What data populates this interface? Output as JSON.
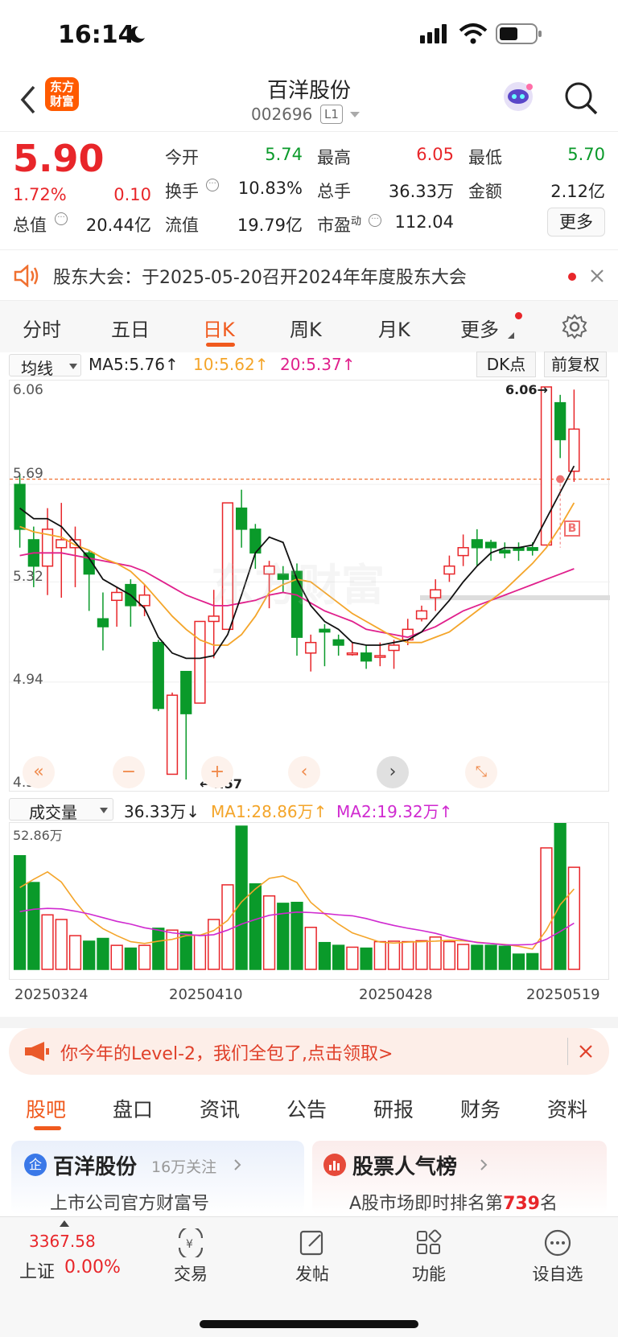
{
  "status": {
    "time": "16:14"
  },
  "header": {
    "logo_text": "东方财富",
    "stock_name": "百洋股份",
    "stock_code": "002696",
    "level": "L1"
  },
  "quote": {
    "price": "5.90",
    "change_pct": "1.72%",
    "change": "0.10",
    "fields": [
      {
        "label": "今开",
        "value": "5.74",
        "color": "green"
      },
      {
        "label": "最高",
        "value": "6.05",
        "color": "red"
      },
      {
        "label": "最低",
        "value": "5.70",
        "color": "green"
      },
      {
        "label": "换手",
        "value": "10.83%",
        "color": "black"
      },
      {
        "label": "总手",
        "value": "36.33万",
        "color": "black"
      },
      {
        "label": "金额",
        "value": "2.12亿",
        "color": "black"
      },
      {
        "label": "总值",
        "value": "20.44亿",
        "color": "black"
      },
      {
        "label": "流值",
        "value": "19.79亿",
        "color": "black"
      },
      {
        "label": "市盈",
        "sup": "动",
        "value": "112.04",
        "color": "black"
      }
    ],
    "more": "更多"
  },
  "notice": {
    "text": "股东大会：于2025-05-20召开2024年年度股东大会"
  },
  "ktabs": [
    "分时",
    "五日",
    "日K",
    "周K",
    "月K",
    "更多"
  ],
  "ktab_active": 2,
  "ma_bar": {
    "selector": "均线",
    "ma5": "MA5:5.76",
    "ma10": "10:5.62",
    "ma20": "20:5.37",
    "dk": "DK点",
    "fq": "前复权"
  },
  "kchart": {
    "ymax": "6.06",
    "y2": "5.69",
    "y3": "5.32",
    "y4": "4.94",
    "ymin": "4.57",
    "hi_label": "6.06→",
    "lo_label": "←4.57",
    "watermark": "东方财富",
    "b_mark": "B"
  },
  "vol_bar": {
    "selector": "成交量",
    "vol": "36.33万",
    "ma1": "MA1:28.86万",
    "ma2": "MA2:19.32万",
    "vmax": "52.86万"
  },
  "dates": [
    "20250324",
    "20250410",
    "20250428",
    "20250519"
  ],
  "banner": {
    "text": "你今年的Level-2，我们全包了,点击领取>"
  },
  "btabs": [
    "股吧",
    "盘口",
    "资讯",
    "公告",
    "研报",
    "财务",
    "资料"
  ],
  "btab_active": 0,
  "card_left": {
    "title": "百洋股份",
    "follow": "16万关注",
    "sub": "上市公司官方财富号"
  },
  "card_right": {
    "title": "股票人气榜",
    "sub_pre": "A股市场即时排名第",
    "rank": "739",
    "sub_post": "名"
  },
  "tabbar": {
    "index_value": "3367.58",
    "index_name": "上证",
    "index_change": "0.00%",
    "items": [
      "交易",
      "发帖",
      "功能",
      "设自选"
    ]
  },
  "chart_data": {
    "type": "candlestick",
    "ylim": [
      4.57,
      6.06
    ],
    "candles": [
      [
        5.69,
        5.52,
        5.73,
        5.45
      ],
      [
        5.48,
        5.38,
        5.53,
        5.3
      ],
      [
        5.38,
        5.52,
        5.6,
        5.27
      ],
      [
        5.45,
        5.48,
        5.62,
        5.26
      ],
      [
        5.45,
        5.48,
        5.53,
        5.3
      ],
      [
        5.43,
        5.35,
        5.44,
        5.21
      ],
      [
        5.18,
        5.15,
        5.28,
        5.06
      ],
      [
        5.25,
        5.28,
        5.3,
        5.15
      ],
      [
        5.31,
        5.23,
        5.33,
        5.15
      ],
      [
        5.23,
        5.27,
        5.31,
        5.19
      ],
      [
        5.09,
        4.84,
        5.1,
        4.83
      ],
      [
        4.59,
        4.89,
        4.9,
        4.59
      ],
      [
        4.98,
        4.82,
        4.98,
        4.57
      ],
      [
        4.86,
        5.17,
        5.17,
        4.86
      ],
      [
        5.17,
        5.19,
        5.29,
        5.03
      ],
      [
        5.14,
        5.62,
        5.62,
        5.14
      ],
      [
        5.6,
        5.52,
        5.67,
        5.45
      ],
      [
        5.52,
        5.43,
        5.54,
        5.37
      ],
      [
        5.35,
        5.38,
        5.4,
        5.22
      ],
      [
        5.35,
        5.33,
        5.38,
        5.28
      ],
      [
        5.36,
        5.11,
        5.39,
        5.04
      ],
      [
        5.05,
        5.09,
        5.12,
        4.98
      ],
      [
        5.14,
        5.13,
        5.16,
        5.0
      ],
      [
        5.1,
        5.08,
        5.12,
        5.04
      ],
      [
        5.05,
        5.05,
        5.09,
        5.04
      ],
      [
        5.05,
        5.02,
        5.08,
        4.99
      ],
      [
        5.04,
        5.04,
        5.09,
        5.0
      ],
      [
        5.06,
        5.08,
        5.1,
        4.99
      ],
      [
        5.1,
        5.14,
        5.18,
        5.08
      ],
      [
        5.18,
        5.21,
        5.23,
        5.17
      ],
      [
        5.26,
        5.29,
        5.33,
        5.21
      ],
      [
        5.35,
        5.38,
        5.42,
        5.32
      ],
      [
        5.42,
        5.45,
        5.5,
        5.38
      ],
      [
        5.48,
        5.45,
        5.52,
        5.38
      ],
      [
        5.47,
        5.45,
        5.48,
        5.4
      ],
      [
        5.44,
        5.43,
        5.47,
        5.41
      ],
      [
        5.45,
        5.44,
        5.47,
        5.4
      ],
      [
        5.45,
        5.44,
        5.47,
        5.42
      ],
      [
        5.46,
        6.06,
        6.06,
        5.47
      ],
      [
        6.0,
        5.86,
        6.03,
        5.79
      ],
      [
        5.74,
        5.9,
        6.05,
        5.7
      ]
    ],
    "ma5": [
      5.6,
      5.56,
      5.56,
      5.53,
      5.47,
      5.41,
      5.33,
      5.3,
      5.27,
      5.22,
      5.11,
      5.05,
      5.03,
      5.03,
      5.04,
      5.12,
      5.27,
      5.43,
      5.49,
      5.47,
      5.33,
      5.23,
      5.17,
      5.14,
      5.09,
      5.08,
      5.08,
      5.09,
      5.1,
      5.13,
      5.19,
      5.25,
      5.32,
      5.38,
      5.43,
      5.45,
      5.45,
      5.46,
      5.56,
      5.66,
      5.76
    ],
    "ma10": [
      5.53,
      5.51,
      5.5,
      5.49,
      5.46,
      5.44,
      5.41,
      5.39,
      5.36,
      5.31,
      5.25,
      5.19,
      5.14,
      5.1,
      5.08,
      5.08,
      5.12,
      5.19,
      5.28,
      5.31,
      5.33,
      5.32,
      5.28,
      5.24,
      5.2,
      5.17,
      5.14,
      5.11,
      5.09,
      5.09,
      5.11,
      5.13,
      5.17,
      5.21,
      5.25,
      5.29,
      5.34,
      5.39,
      5.45,
      5.53,
      5.62
    ],
    "ma20": [
      5.42,
      5.43,
      5.43,
      5.43,
      5.42,
      5.41,
      5.4,
      5.39,
      5.38,
      5.36,
      5.33,
      5.3,
      5.27,
      5.25,
      5.23,
      5.23,
      5.24,
      5.25,
      5.27,
      5.28,
      5.27,
      5.24,
      5.21,
      5.19,
      5.17,
      5.14,
      5.13,
      5.12,
      5.11,
      5.13,
      5.15,
      5.18,
      5.21,
      5.23,
      5.25,
      5.27,
      5.29,
      5.31,
      5.33,
      5.35,
      5.37
    ],
    "volume": [
      24.6,
      18.8,
      11.8,
      10.8,
      7.3,
      6.1,
      6.7,
      5.2,
      4.6,
      5.2,
      8.9,
      8.5,
      8.1,
      7.4,
      10.8,
      18.3,
      31.0,
      18.5,
      15.9,
      14.3,
      14.5,
      9.1,
      5.8,
      5.2,
      4.8,
      4.6,
      6.0,
      6.1,
      6.0,
      6.2,
      7.0,
      6.0,
      5.4,
      5.2,
      5.2,
      5.0,
      3.3,
      3.4,
      26.3,
      32.3,
      22.1
    ],
    "vol_ma1": [
      17.7,
      19.5,
      21.1,
      18.9,
      14.7,
      11.0,
      8.8,
      7.3,
      6.0,
      5.6,
      6.1,
      6.5,
      7.3,
      7.4,
      8.4,
      10.6,
      14.6,
      17.4,
      19.7,
      20.2,
      18.8,
      14.5,
      12.0,
      9.8,
      7.9,
      6.9,
      5.9,
      5.7,
      5.9,
      6.0,
      6.1,
      6.3,
      6.2,
      5.9,
      5.6,
      5.4,
      5.0,
      4.4,
      8.5,
      14.0,
      17.4
    ],
    "vol_ma2": [
      12.5,
      13.0,
      13.2,
      13.1,
      12.6,
      12.0,
      11.2,
      10.4,
      9.8,
      9.0,
      8.5,
      7.9,
      7.6,
      7.3,
      7.5,
      8.5,
      9.8,
      10.8,
      11.7,
      12.1,
      12.4,
      12.3,
      12.1,
      11.8,
      11.6,
      11.0,
      10.2,
      9.5,
      8.9,
      8.4,
      7.8,
      7.0,
      6.4,
      5.8,
      5.6,
      5.3,
      5.3,
      5.4,
      6.5,
      8.2,
      10.0
    ]
  }
}
